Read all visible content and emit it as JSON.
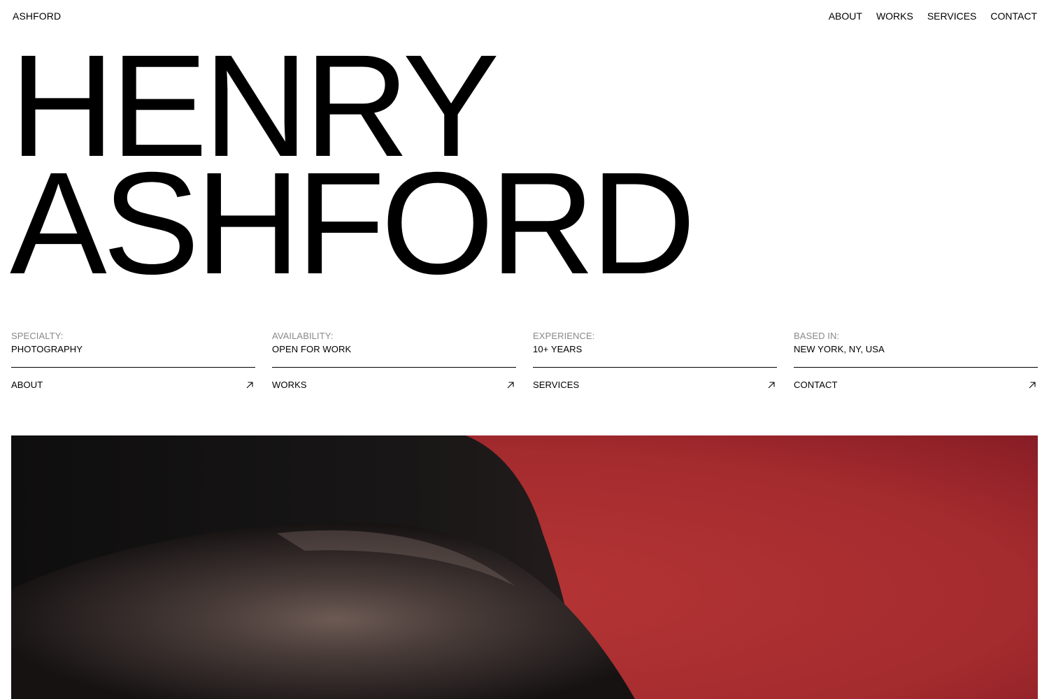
{
  "header": {
    "brand": "ASHFORD",
    "nav": [
      "ABOUT",
      "WORKS",
      "SERVICES",
      "CONTACT"
    ]
  },
  "hero": {
    "name_line_1": "HENRY",
    "name_line_2": "ASHFORD"
  },
  "info": [
    {
      "label": "SPECIALTY:",
      "value": "PHOTOGRAPHY",
      "link": "ABOUT",
      "icon": "arrow-up-right-icon"
    },
    {
      "label": "AVAILABILITY:",
      "value": "OPEN FOR WORK",
      "link": "WORKS",
      "icon": "arrow-up-right-icon"
    },
    {
      "label": "EXPERIENCE:",
      "value": "10+ YEARS",
      "link": "SERVICES",
      "icon": "arrow-up-right-icon"
    },
    {
      "label": "BASED IN:",
      "value": "NEW YORK, NY, USA",
      "link": "CONTACT",
      "icon": "arrow-up-right-icon"
    }
  ],
  "colors": {
    "text": "#000000",
    "label": "#8a8a8a",
    "background": "#ffffff",
    "photo_backdrop": "#a82e2e"
  }
}
